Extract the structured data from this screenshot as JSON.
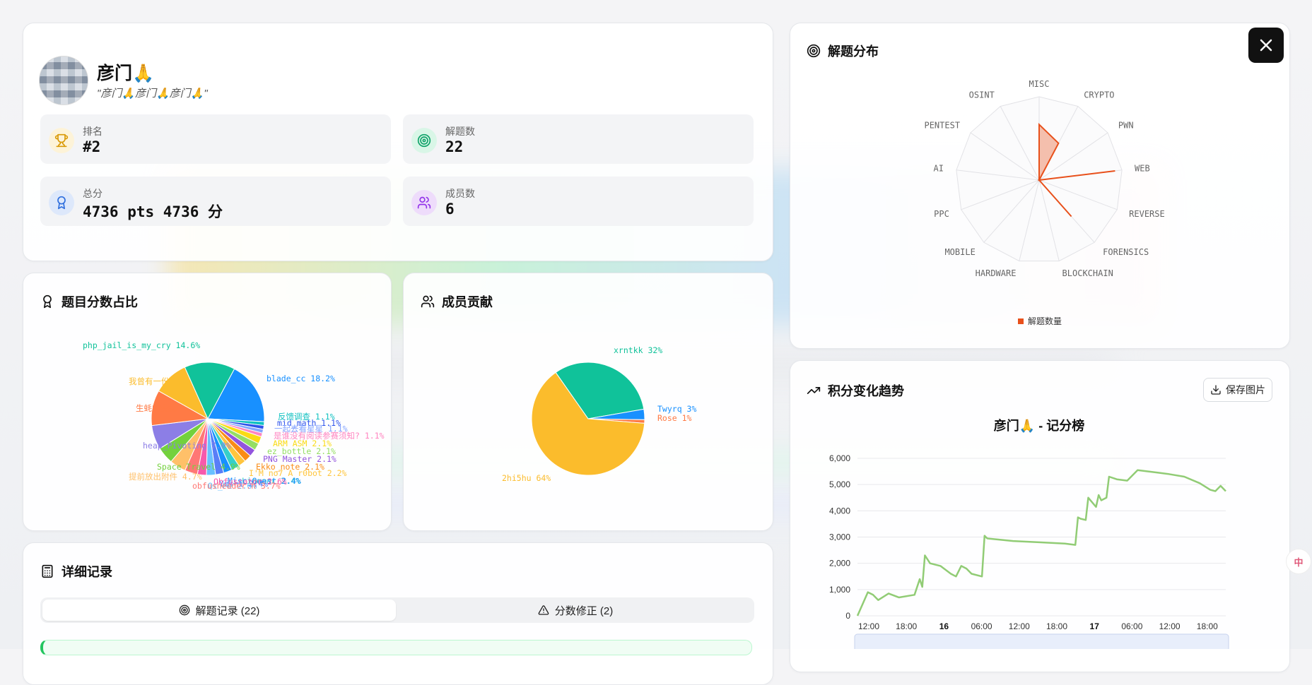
{
  "team": {
    "name": "彦门🙏",
    "motto": "\"彦门🙏彦门🙏彦门🙏\"",
    "stats": [
      {
        "label": "排名",
        "value": "#2",
        "icon": "trophy-icon",
        "color": "#f59e0b"
      },
      {
        "label": "解题数",
        "value": "22",
        "icon": "target-icon",
        "color": "#10b981"
      },
      {
        "label": "总分",
        "value": "4736 pts  4736 分",
        "icon": "award-icon",
        "color": "#3b82f6"
      },
      {
        "label": "成员数",
        "value": "6",
        "icon": "users-icon",
        "color": "#a855f7"
      }
    ]
  },
  "radar": {
    "title": "解题分布",
    "categories": [
      "MISC",
      "CRYPTO",
      "PWN",
      "WEB",
      "REVERSE",
      "FORENSICS",
      "BLOCKCHAIN",
      "HARDWARE",
      "MOBILE",
      "PPC",
      "AI",
      "PENTEST",
      "OSINT"
    ],
    "values": [
      8,
      6,
      0,
      11,
      0,
      7,
      0,
      0,
      0,
      0,
      0,
      0,
      0
    ],
    "max": 12,
    "legend": "解题数量",
    "color": "#e8501b"
  },
  "score_pie": {
    "title": "题目分数占比",
    "slices": [
      {
        "label": "blade_cc 18.2%",
        "value": 18.2,
        "color": "#1890ff"
      },
      {
        "label": "反馈调查 1.1%",
        "value": 1.1,
        "color": "#13c2c2"
      },
      {
        "label": "mid_math 1.1%",
        "value": 1.1,
        "color": "#2f54eb"
      },
      {
        "label": "一起去看星星 1.1%",
        "value": 1.1,
        "color": "#85a5ff"
      },
      {
        "label": "是谁没有阅读参赛须知? 1.1%",
        "value": 1.1,
        "color": "#ff85c0"
      },
      {
        "label": "ARM ASM 2.1%",
        "value": 2.1,
        "color": "#fadb14"
      },
      {
        "label": "ez_bottle 2.1%",
        "value": 2.1,
        "color": "#95de64"
      },
      {
        "label": "PNG Master 2.1%",
        "value": 2.1,
        "color": "#9254de"
      },
      {
        "label": "Ekko_note 2.1%",
        "value": 2.1,
        "color": "#fa8c16"
      },
      {
        "label": "I'M no7 A r0bot 2.2%",
        "value": 2.2,
        "color": "#ffc53d"
      },
      {
        "label": "Lineaar 2.4%",
        "value": 2.4,
        "color": "#36cfc9"
      },
      {
        "label": "Misc_Quest 2.4%",
        "value": 2.4,
        "color": "#1890ff"
      },
      {
        "label": "Yoshi 2.4%",
        "value": 2.4,
        "color": "#597ef7"
      },
      {
        "label": "Qt_Pe 2.6%",
        "value": 2.6,
        "color": "#69c0ff"
      },
      {
        "label": "Obfuscator 2.6%",
        "value": 2.6,
        "color": "#f759ab"
      },
      {
        "label": "obfusheader.h 3.7%",
        "value": 3.7,
        "color": "#ff7875"
      },
      {
        "label": "提前放出附件 4.7%",
        "value": 4.7,
        "color": "#ffc069"
      },
      {
        "label": "Space Travel 4.9%",
        "value": 4.9,
        "color": "#73d13d"
      },
      {
        "label": "heap_Pivoting 7.0%",
        "value": 7.0,
        "color": "#8c7ee6"
      },
      {
        "label": "生蚝的宝藏 10.2%",
        "value": 10.2,
        "color": "#ff7a45"
      },
      {
        "label": "我曾有一份工作 10.2%",
        "value": 10.2,
        "color": "#fbbc2c"
      },
      {
        "label": "php_jail_is_my_cry 14.6%",
        "value": 14.6,
        "color": "#10c29a"
      }
    ]
  },
  "member_pie": {
    "title": "成员贡献",
    "slices": [
      {
        "label": "xrntkk 32%",
        "value": 32,
        "color": "#10c29a"
      },
      {
        "label": "Twyrq 3%",
        "value": 3,
        "color": "#1890ff"
      },
      {
        "label": "Rose 1%",
        "value": 1,
        "color": "#ff7a45"
      },
      {
        "label": "2hi5hu 64%",
        "value": 64,
        "color": "#fbbc2c"
      }
    ]
  },
  "trend": {
    "title": "积分变化趋势",
    "save_label": "保存图片",
    "chart_title": "彦门🙏 - 记分榜",
    "y_ticks": [
      "0",
      "1,000",
      "2,000",
      "3,000",
      "4,000",
      "5,000",
      "6,000"
    ],
    "x_ticks": [
      {
        "label": "12:00",
        "bold": false
      },
      {
        "label": "18:00",
        "bold": false
      },
      {
        "label": "16",
        "bold": true
      },
      {
        "label": "06:00",
        "bold": false
      },
      {
        "label": "12:00",
        "bold": false
      },
      {
        "label": "18:00",
        "bold": false
      },
      {
        "label": "17",
        "bold": true
      },
      {
        "label": "06:00",
        "bold": false
      },
      {
        "label": "12:00",
        "bold": false
      },
      {
        "label": "18:00",
        "bold": false
      }
    ],
    "color": "#91cc75"
  },
  "chart_data": {
    "type": "line",
    "title": "彦门🙏 - 记分榜",
    "xlabel": "",
    "ylabel": "",
    "ylim": [
      0,
      6000
    ],
    "x": [
      0,
      2,
      3,
      4,
      6,
      8,
      11,
      12,
      12.5,
      13,
      14,
      16,
      18,
      19,
      20,
      21,
      22,
      24,
      24.5,
      25,
      30,
      35,
      40,
      42,
      42.5,
      43,
      44,
      44.5,
      46,
      46.5,
      47,
      48,
      48.5,
      50,
      52,
      54,
      58,
      60,
      63,
      66,
      68,
      69,
      70,
      71
    ],
    "series": [
      {
        "values": [
          0,
          900,
          800,
          600,
          850,
          700,
          800,
          1400,
          1100,
          2300,
          2000,
          1900,
          1600,
          1500,
          1900,
          1800,
          1600,
          1500,
          3050,
          2950,
          2850,
          2800,
          2750,
          2700,
          3750,
          3700,
          3650,
          4500,
          4150,
          4600,
          4400,
          4500,
          5300,
          5200,
          5150,
          5550,
          5450,
          5400,
          5300,
          5050,
          4800,
          4750,
          4950,
          4750
        ]
      }
    ]
  },
  "details": {
    "title": "详细记录",
    "tabs": [
      {
        "label": "解题记录 (22)",
        "icon": "target-icon"
      },
      {
        "label": "分数修正 (2)",
        "icon": "warning-icon"
      }
    ]
  }
}
